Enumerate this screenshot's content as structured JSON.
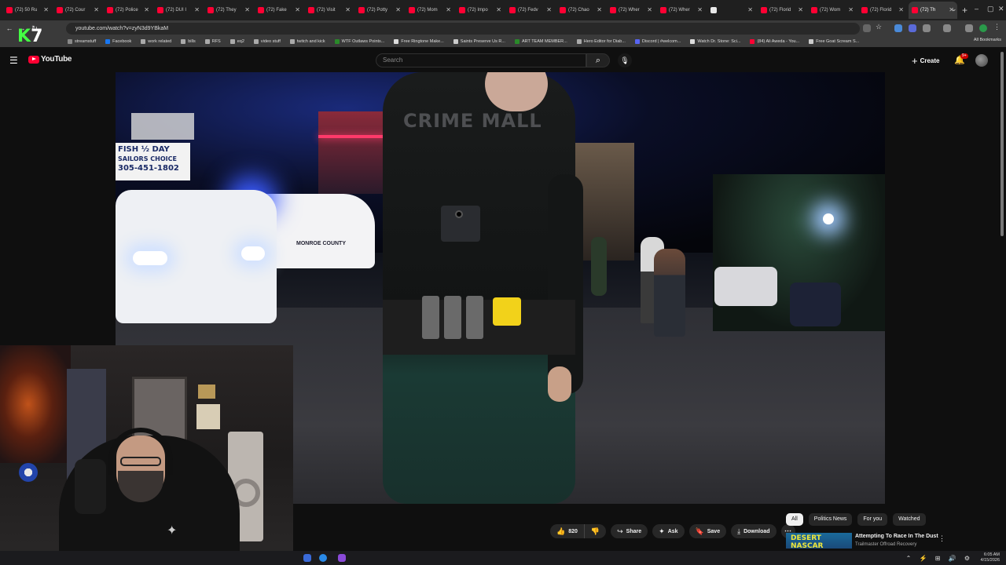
{
  "browser": {
    "tabs": [
      {
        "label": "(72) 50 Ru"
      },
      {
        "label": "(72) Cour"
      },
      {
        "label": "(72) Police"
      },
      {
        "label": "(72) DUI I"
      },
      {
        "label": "(72) They"
      },
      {
        "label": "(72) Fake"
      },
      {
        "label": "(72) Visit"
      },
      {
        "label": "(72) Potty"
      },
      {
        "label": "(72) Mom"
      },
      {
        "label": "(72) Impo"
      },
      {
        "label": "(72) Fedv"
      },
      {
        "label": "(72) Chao"
      },
      {
        "label": "(72) Wher"
      },
      {
        "label": "(72) Wher"
      },
      {
        "label": ""
      },
      {
        "label": "(72) Florid"
      },
      {
        "label": "(72) Wom"
      },
      {
        "label": "(72) Florid"
      },
      {
        "label": "(72) Th"
      }
    ],
    "url": "youtube.com/watch?v=zyN3d9YBkaM",
    "bookmarks": [
      {
        "label": "streamstuff"
      },
      {
        "label": "Facebook"
      },
      {
        "label": "work related"
      },
      {
        "label": "bills"
      },
      {
        "label": "RFS"
      },
      {
        "label": "eq2"
      },
      {
        "label": "video stuff"
      },
      {
        "label": "twitch and kick"
      },
      {
        "label": "WTF Outlaws Points..."
      },
      {
        "label": "Free Ringtone Make..."
      },
      {
        "label": "Saints Preserve Us R..."
      },
      {
        "label": "ART TEAM MEMBER..."
      },
      {
        "label": "Hero Editor for Diab..."
      },
      {
        "label": "Discord | #welcom..."
      },
      {
        "label": "Watch Dr. Stone: Sci..."
      },
      {
        "label": "(84) Ali Aweda - You..."
      },
      {
        "label": "Free Goat Scream S..."
      }
    ],
    "all_bookmarks": "All Bookmarks"
  },
  "overlay_logo": {
    "k": "K",
    "seven": "7"
  },
  "youtube": {
    "logo_text": "YouTube",
    "search_placeholder": "Search",
    "create_label": "Create",
    "notif_badge": "9+"
  },
  "video": {
    "watermark": "CRIME MALL",
    "sign_text_1": "FISH ½ DAY",
    "sign_text_2": "SAILORS CHOICE",
    "sign_text_3": "305-451-1802",
    "car_text": "MONROE COUNTY"
  },
  "actions": {
    "like_count": "820",
    "share": "Share",
    "ask": "Ask",
    "save": "Save",
    "download": "Download"
  },
  "chips": [
    {
      "label": "All"
    },
    {
      "label": "Politics News"
    },
    {
      "label": "For you"
    },
    {
      "label": "Watched"
    }
  ],
  "recommendation": {
    "thumb_text": "DESERT NASCAR",
    "title": "Attempting To Race In The Dust",
    "channel": "Trailmaster Offroad Recovery"
  },
  "tray": {
    "time": "6:05 AM",
    "date": "4/15/2026"
  },
  "colors": {
    "youtube_red": "#ff0033",
    "bg": "#0f0f0f",
    "chip_active": "#f1f1f1"
  }
}
